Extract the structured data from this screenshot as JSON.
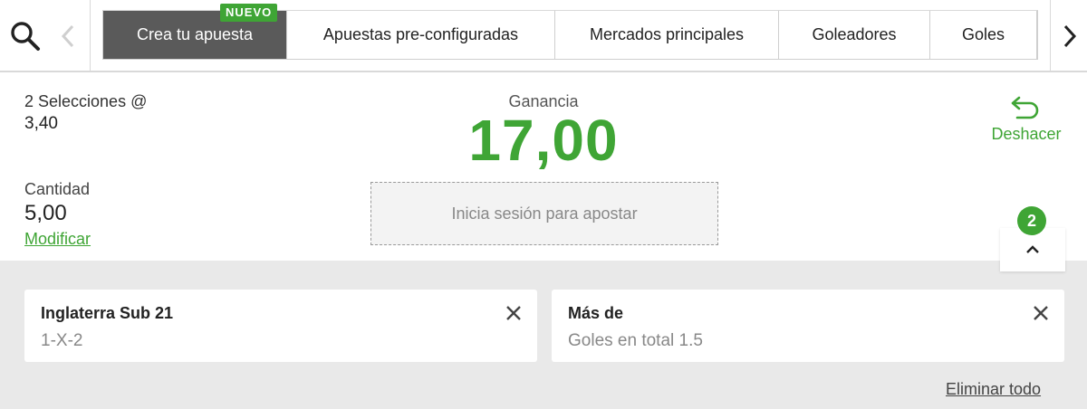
{
  "tabs": [
    {
      "label": "Crea tu apuesta",
      "active": true
    },
    {
      "label": "Apuestas pre-configuradas",
      "active": false
    },
    {
      "label": "Mercados principales",
      "active": false
    },
    {
      "label": "Goleadores",
      "active": false
    },
    {
      "label": "Goles",
      "active": false
    }
  ],
  "new_badge": "NUEVO",
  "icons": {
    "search": "search-icon",
    "prev": "chevron-left-icon",
    "next": "chevron-right-icon",
    "undo": "undo-arrow-icon",
    "collapse": "chevron-up-icon",
    "close": "close-icon"
  },
  "summary": {
    "selections_label": "2 Selecciones @",
    "odds": "3,40",
    "winnings_label": "Ganancia",
    "winnings_value": "17,00",
    "undo_label": "Deshacer",
    "stake_label": "Cantidad",
    "stake_value": "5,00",
    "modify_label": "Modificar",
    "login_button": "Inicia sesión para apostar",
    "selection_count": "2"
  },
  "selections": [
    {
      "title": "Inglaterra Sub 21",
      "market": "1-X-2"
    },
    {
      "title": "Más de",
      "market": "Goles en total 1.5"
    }
  ],
  "remove_all": "Eliminar todo",
  "colors": {
    "accent": "#3fa535",
    "active_tab": "#5a5a5a",
    "selections_bg": "#e9e9e9"
  }
}
